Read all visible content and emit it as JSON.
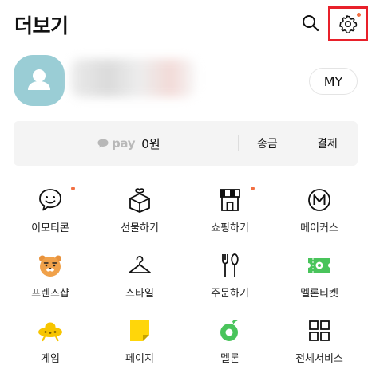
{
  "header": {
    "title": "더보기",
    "search_icon": "search-icon",
    "settings_icon": "gear-icon",
    "highlight_color": "#e8202a",
    "notification_dot_color": "#f26f42"
  },
  "profile": {
    "avatar_color": "#9acdd5",
    "my_label": "MY"
  },
  "pay": {
    "logo": "pay",
    "amount": "0원",
    "transfer_label": "송금",
    "payment_label": "결제"
  },
  "grid": [
    {
      "label": "이모티콘",
      "icon": "smiley-icon",
      "badge": true
    },
    {
      "label": "선물하기",
      "icon": "gift-icon",
      "badge": false
    },
    {
      "label": "쇼핑하기",
      "icon": "shop-icon",
      "badge": true
    },
    {
      "label": "메이커스",
      "icon": "makers-icon",
      "badge": false
    },
    {
      "label": "프렌즈샵",
      "icon": "ryan-icon",
      "badge": false
    },
    {
      "label": "스타일",
      "icon": "hanger-icon",
      "badge": false
    },
    {
      "label": "주문하기",
      "icon": "fork-knife-icon",
      "badge": false
    },
    {
      "label": "멜론티켓",
      "icon": "ticket-icon",
      "badge": false
    },
    {
      "label": "게임",
      "icon": "ufo-icon",
      "badge": false
    },
    {
      "label": "페이지",
      "icon": "page-icon",
      "badge": false
    },
    {
      "label": "멜론",
      "icon": "melon-icon",
      "badge": false
    },
    {
      "label": "전체서비스",
      "icon": "grid-icon",
      "badge": false
    }
  ]
}
